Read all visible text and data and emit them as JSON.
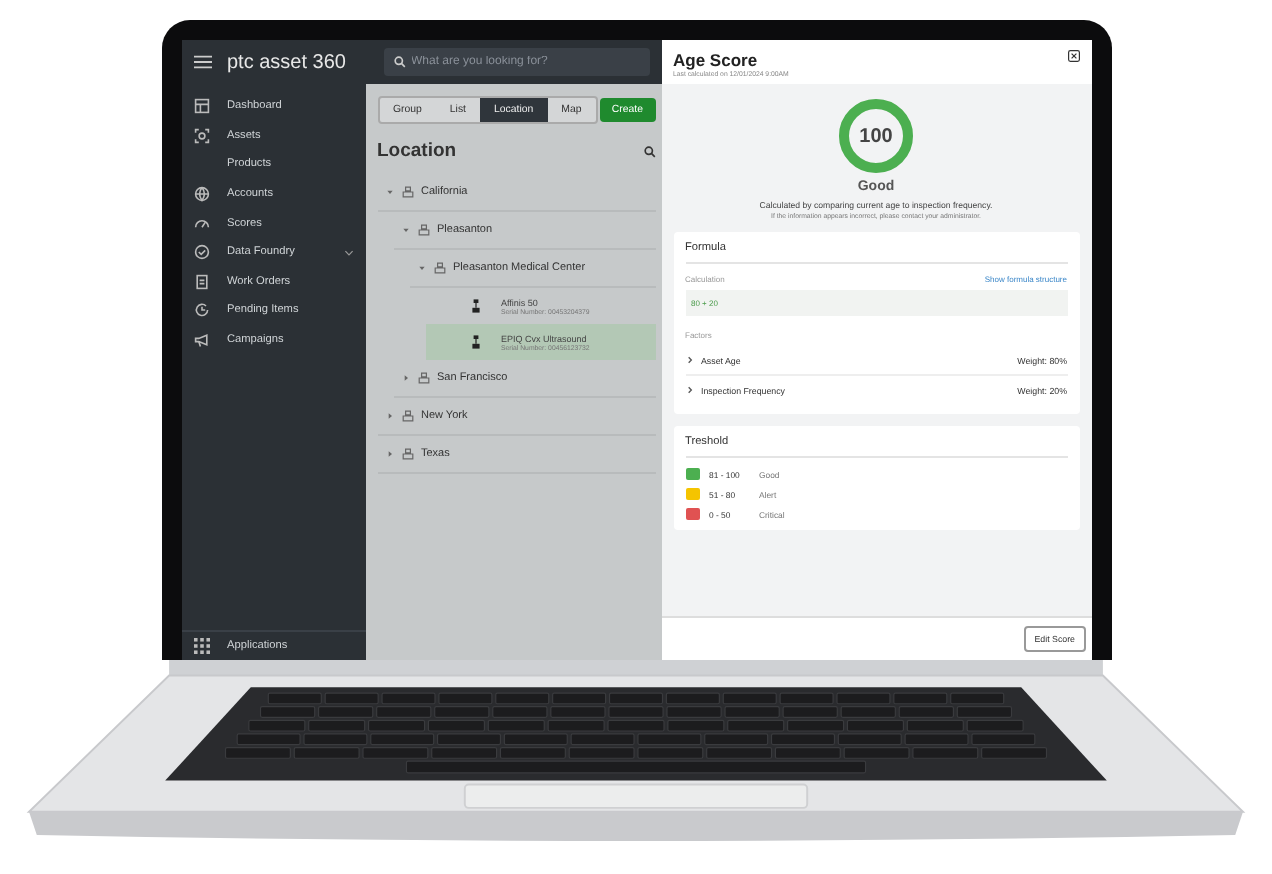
{
  "app": {
    "logo": "ptc asset 360",
    "search": {
      "placeholder": "What are you looking for?"
    }
  },
  "sidebar": {
    "items": [
      {
        "label": "Dashboard",
        "selected": false
      },
      {
        "label": "Assets",
        "selected": false
      },
      {
        "label": "Products",
        "selected": false
      },
      {
        "label": "Accounts",
        "selected": false
      },
      {
        "label": "Scores",
        "selected": false
      },
      {
        "label": "Data Foundry",
        "selected": false,
        "has_submenu": true
      },
      {
        "label": "Work Orders",
        "selected": false
      },
      {
        "label": "Pending Items",
        "selected": false
      },
      {
        "label": "Campaigns",
        "selected": false
      }
    ],
    "footer": "Applications"
  },
  "view_tabs": [
    {
      "label": "Group",
      "selected": false
    },
    {
      "label": "List",
      "selected": false
    },
    {
      "label": "Location",
      "selected": true
    },
    {
      "label": "Map",
      "selected": false
    }
  ],
  "create_button": "Create",
  "page_title": "Location",
  "tree": [
    {
      "kind": "location",
      "label": "California",
      "expanded": true,
      "children": [
        {
          "kind": "location",
          "label": "Pleasanton",
          "expanded": true,
          "children": [
            {
              "kind": "location",
              "label": "Pleasanton Medical Center",
              "expanded": true,
              "children": [
                {
                  "kind": "asset",
                  "label": "Affinis 50",
                  "serial": "Serial Number: 00453204379",
                  "selected": false
                },
                {
                  "kind": "asset",
                  "label": "EPIQ Cvx Ultrasound",
                  "serial": "Serial Number: 00456123732",
                  "selected": true
                }
              ]
            }
          ]
        },
        {
          "kind": "location",
          "label": "San Francisco",
          "expanded": false
        }
      ]
    },
    {
      "kind": "location",
      "label": "New York",
      "expanded": false
    },
    {
      "kind": "location",
      "label": "Texas",
      "expanded": false
    }
  ],
  "panel": {
    "title": "Age Score",
    "subtitle": "Last calculated on 12/01/2024 9:00AM",
    "score": {
      "value": "100",
      "level": 1,
      "rating": "Good",
      "description": "Calculated by comparing current age to inspection frequency.",
      "note": "If the information appears incorrect, please contact your administrator."
    },
    "formula": {
      "title": "Formula",
      "calculation_label": "Calculation",
      "link": "Show formula structure",
      "expression": "80 + 20",
      "factors_label": "Factors",
      "factors": [
        {
          "label": "Asset Age",
          "weight": "Weight: 80%",
          "expanded": false
        },
        {
          "label": "Inspection Frequency",
          "weight": "Weight: 20%",
          "expanded": false
        }
      ]
    },
    "threshold": {
      "title": "Treshold",
      "items": [
        {
          "range": "81 - 100",
          "label": "Good",
          "color": "#4caf50"
        },
        {
          "range": "51 - 80",
          "label": "Alert",
          "color": "#f5c400"
        },
        {
          "range": "0 - 50",
          "label": "Critical",
          "color": "#e05252"
        }
      ]
    },
    "edit_button": "Edit Score"
  }
}
